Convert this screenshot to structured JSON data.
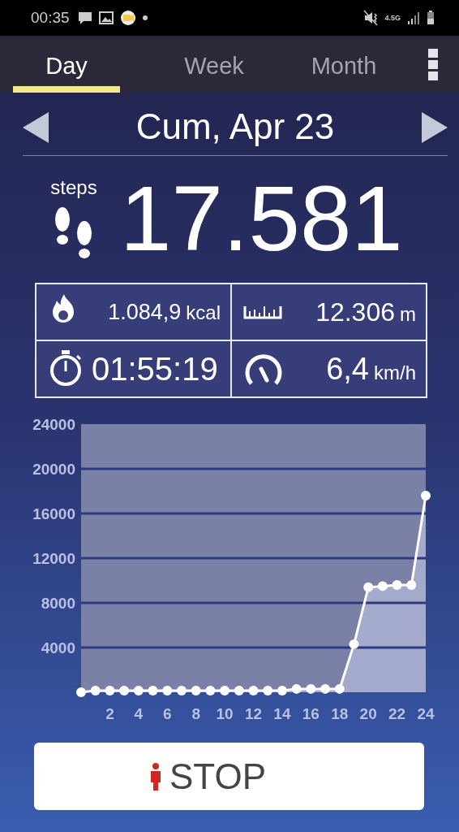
{
  "status_bar": {
    "time": "00:35",
    "network": "4.5G"
  },
  "tabs": [
    {
      "label": "Day",
      "selected": true
    },
    {
      "label": "Week",
      "selected": false
    },
    {
      "label": "Month",
      "selected": false
    }
  ],
  "date": "Cum, Apr 23",
  "steps": {
    "label": "steps",
    "value": "17.581"
  },
  "stats": [
    {
      "kind": "calories",
      "value": "1.084,9",
      "unit": "kcal"
    },
    {
      "kind": "distance",
      "value": "12.306",
      "unit": "m"
    },
    {
      "kind": "duration",
      "value": "01:55:19"
    },
    {
      "kind": "speed",
      "value": "6,4",
      "unit": "km/h"
    }
  ],
  "chart_data": {
    "type": "area",
    "x": [
      0,
      1,
      2,
      3,
      4,
      5,
      6,
      7,
      8,
      9,
      10,
      11,
      12,
      13,
      14,
      15,
      16,
      17,
      18,
      19,
      20,
      21,
      22,
      23,
      24
    ],
    "series": [
      {
        "color": "#ffffff",
        "values": [
          0,
          150,
          150,
          150,
          150,
          150,
          150,
          150,
          150,
          150,
          150,
          150,
          150,
          150,
          150,
          300,
          300,
          300,
          300,
          4300,
          9400,
          9500,
          9600,
          9600,
          17600
        ]
      }
    ],
    "grid": true,
    "xlim": [
      0,
      24
    ],
    "ylim": [
      0,
      24000
    ],
    "xticks": [
      2,
      4,
      6,
      8,
      10,
      12,
      14,
      16,
      18,
      20,
      22,
      24
    ],
    "yticks": [
      4000,
      8000,
      12000,
      16000,
      20000,
      24000
    ]
  },
  "button": {
    "label": "STOP"
  }
}
